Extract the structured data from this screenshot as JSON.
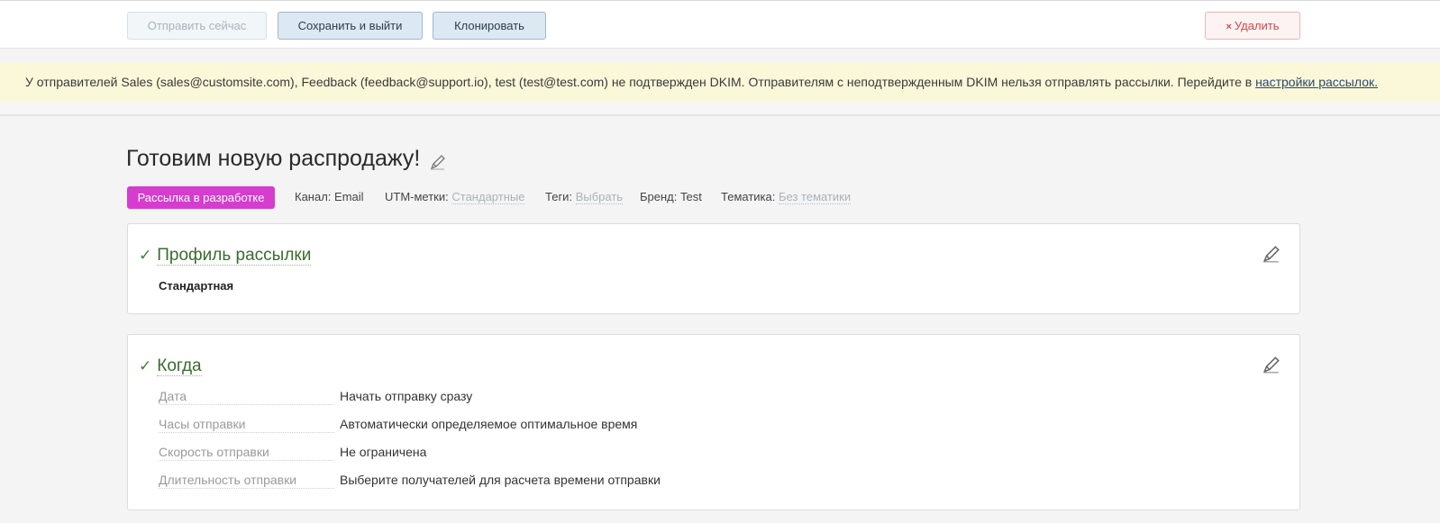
{
  "toolbar": {
    "send_now": "Отправить сейчас",
    "save_exit": "Сохранить и выйти",
    "clone": "Клонировать",
    "delete_icon": "×",
    "delete": "Удалить"
  },
  "banner": {
    "text": "У отправителей Sales (sales@customsite.com), Feedback (feedback@support.io), test (test@test.com) не подтвержден DKIM. Отправителям с неподтвержденным DKIM нельзя отправлять рассылки. Перейдите в ",
    "link": "настройки рассылок."
  },
  "campaign": {
    "title": "Готовим новую распродажу!",
    "status": "Рассылка в разработке",
    "channel_label": "Канал:",
    "channel_value": "Email",
    "utm_label": "UTM-метки:",
    "utm_value": "Стандартные",
    "tags_label": "Теги:",
    "tags_value": "Выбрать",
    "brand_label": "Бренд:",
    "brand_value": "Test",
    "topic_label": "Тематика:",
    "topic_value": "Без тематики"
  },
  "profile_section": {
    "title": "Профиль рассылки",
    "value": "Стандартная"
  },
  "when_section": {
    "title": "Когда",
    "rows": [
      {
        "label": "Дата",
        "value": "Начать отправку сразу"
      },
      {
        "label": "Часы отправки",
        "value": "Автоматически определяемое оптимальное время"
      },
      {
        "label": "Скорость отправки",
        "value": "Не ограничена"
      },
      {
        "label": "Длительность отправки",
        "value": "Выберите получателей для расчета времени отправки"
      }
    ]
  },
  "colors": {
    "status_badge": "#d63ccf",
    "banner_bg": "#fbf7d9",
    "check_green": "#3f7d3f"
  },
  "icons": [
    "pencil-icon",
    "check-icon",
    "close-icon"
  ]
}
